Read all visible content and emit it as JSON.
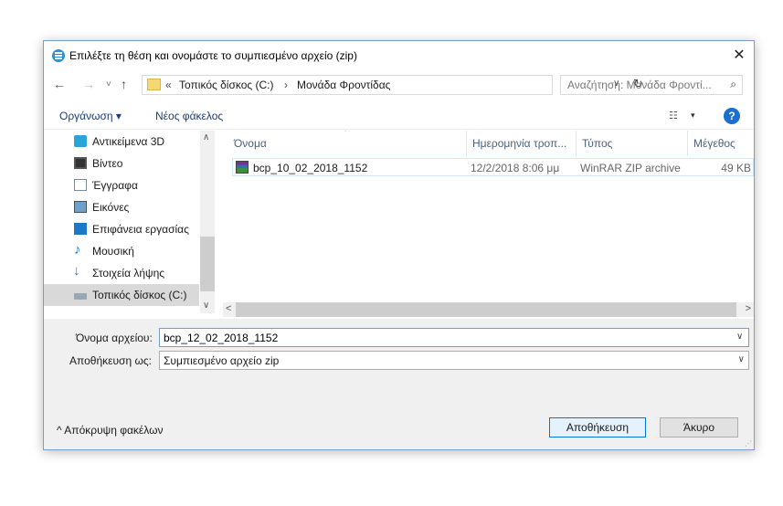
{
  "dialog": {
    "title": "Επιλέξτε τη θέση και ονομάστε το συμπιεσμένο αρχείο (zip)",
    "close_glyph": "✕"
  },
  "nav": {
    "back_glyph": "←",
    "forward_glyph": "→",
    "recent_glyph": "˅",
    "up_glyph": "↑",
    "breadcrumb_chevron": "«",
    "breadcrumb": [
      "Τοπικός δίσκος (C:)",
      "Μονάδα Φροντίδας"
    ],
    "breadcrumb_sep": "›",
    "dropdown_glyph": "∨",
    "refresh_glyph": "↻",
    "search_placeholder": "Αναζήτηση: Μονάδα Φροντί...",
    "search_glyph": "⌕"
  },
  "toolbar": {
    "organize": "Οργάνωση ▾",
    "new_folder": "Νέος φάκελος",
    "view_glyph": "☷",
    "view_drop": "▾",
    "help": "?"
  },
  "sidebar": {
    "items": [
      {
        "label": "Αντικείμενα 3D",
        "icon": "cube-3d-icon"
      },
      {
        "label": "Βίντεο",
        "icon": "video-icon"
      },
      {
        "label": "Έγγραφα",
        "icon": "documents-icon"
      },
      {
        "label": "Εικόνες",
        "icon": "pictures-icon"
      },
      {
        "label": "Επιφάνεια εργασίας",
        "icon": "desktop-icon"
      },
      {
        "label": "Μουσική",
        "icon": "music-icon"
      },
      {
        "label": "Στοιχεία λήψης",
        "icon": "downloads-icon"
      },
      {
        "label": "Τοπικός δίσκος (C:)",
        "icon": "drive-icon",
        "selected": true
      }
    ],
    "scroll_up": "∧",
    "scroll_down": "∨"
  },
  "columns": {
    "name": "Όνομα",
    "date": "Ημερομηνία τροπ...",
    "type": "Τύπος",
    "size": "Μέγεθος",
    "sort_glyph": "^"
  },
  "files": [
    {
      "name": "bcp_10_02_2018_1152",
      "date": "12/2/2018 8:06 μμ",
      "type": "WinRAR ZIP archive",
      "size": "49 KB"
    }
  ],
  "hscroll": {
    "left": "<",
    "right": ">"
  },
  "form": {
    "filename_label": "Όνομα αρχείου:",
    "filename_value": "bcp_12_02_2018_1152",
    "savetype_label": "Αποθήκευση ως:",
    "savetype_value": "Συμπιεσμένο αρχείο zip",
    "drop_glyph": "∨"
  },
  "footer": {
    "hide_folders": "^  Απόκρυψη φακέλων",
    "save": "Αποθήκευση",
    "cancel": "Άκυρο",
    "grip": "⋰"
  }
}
